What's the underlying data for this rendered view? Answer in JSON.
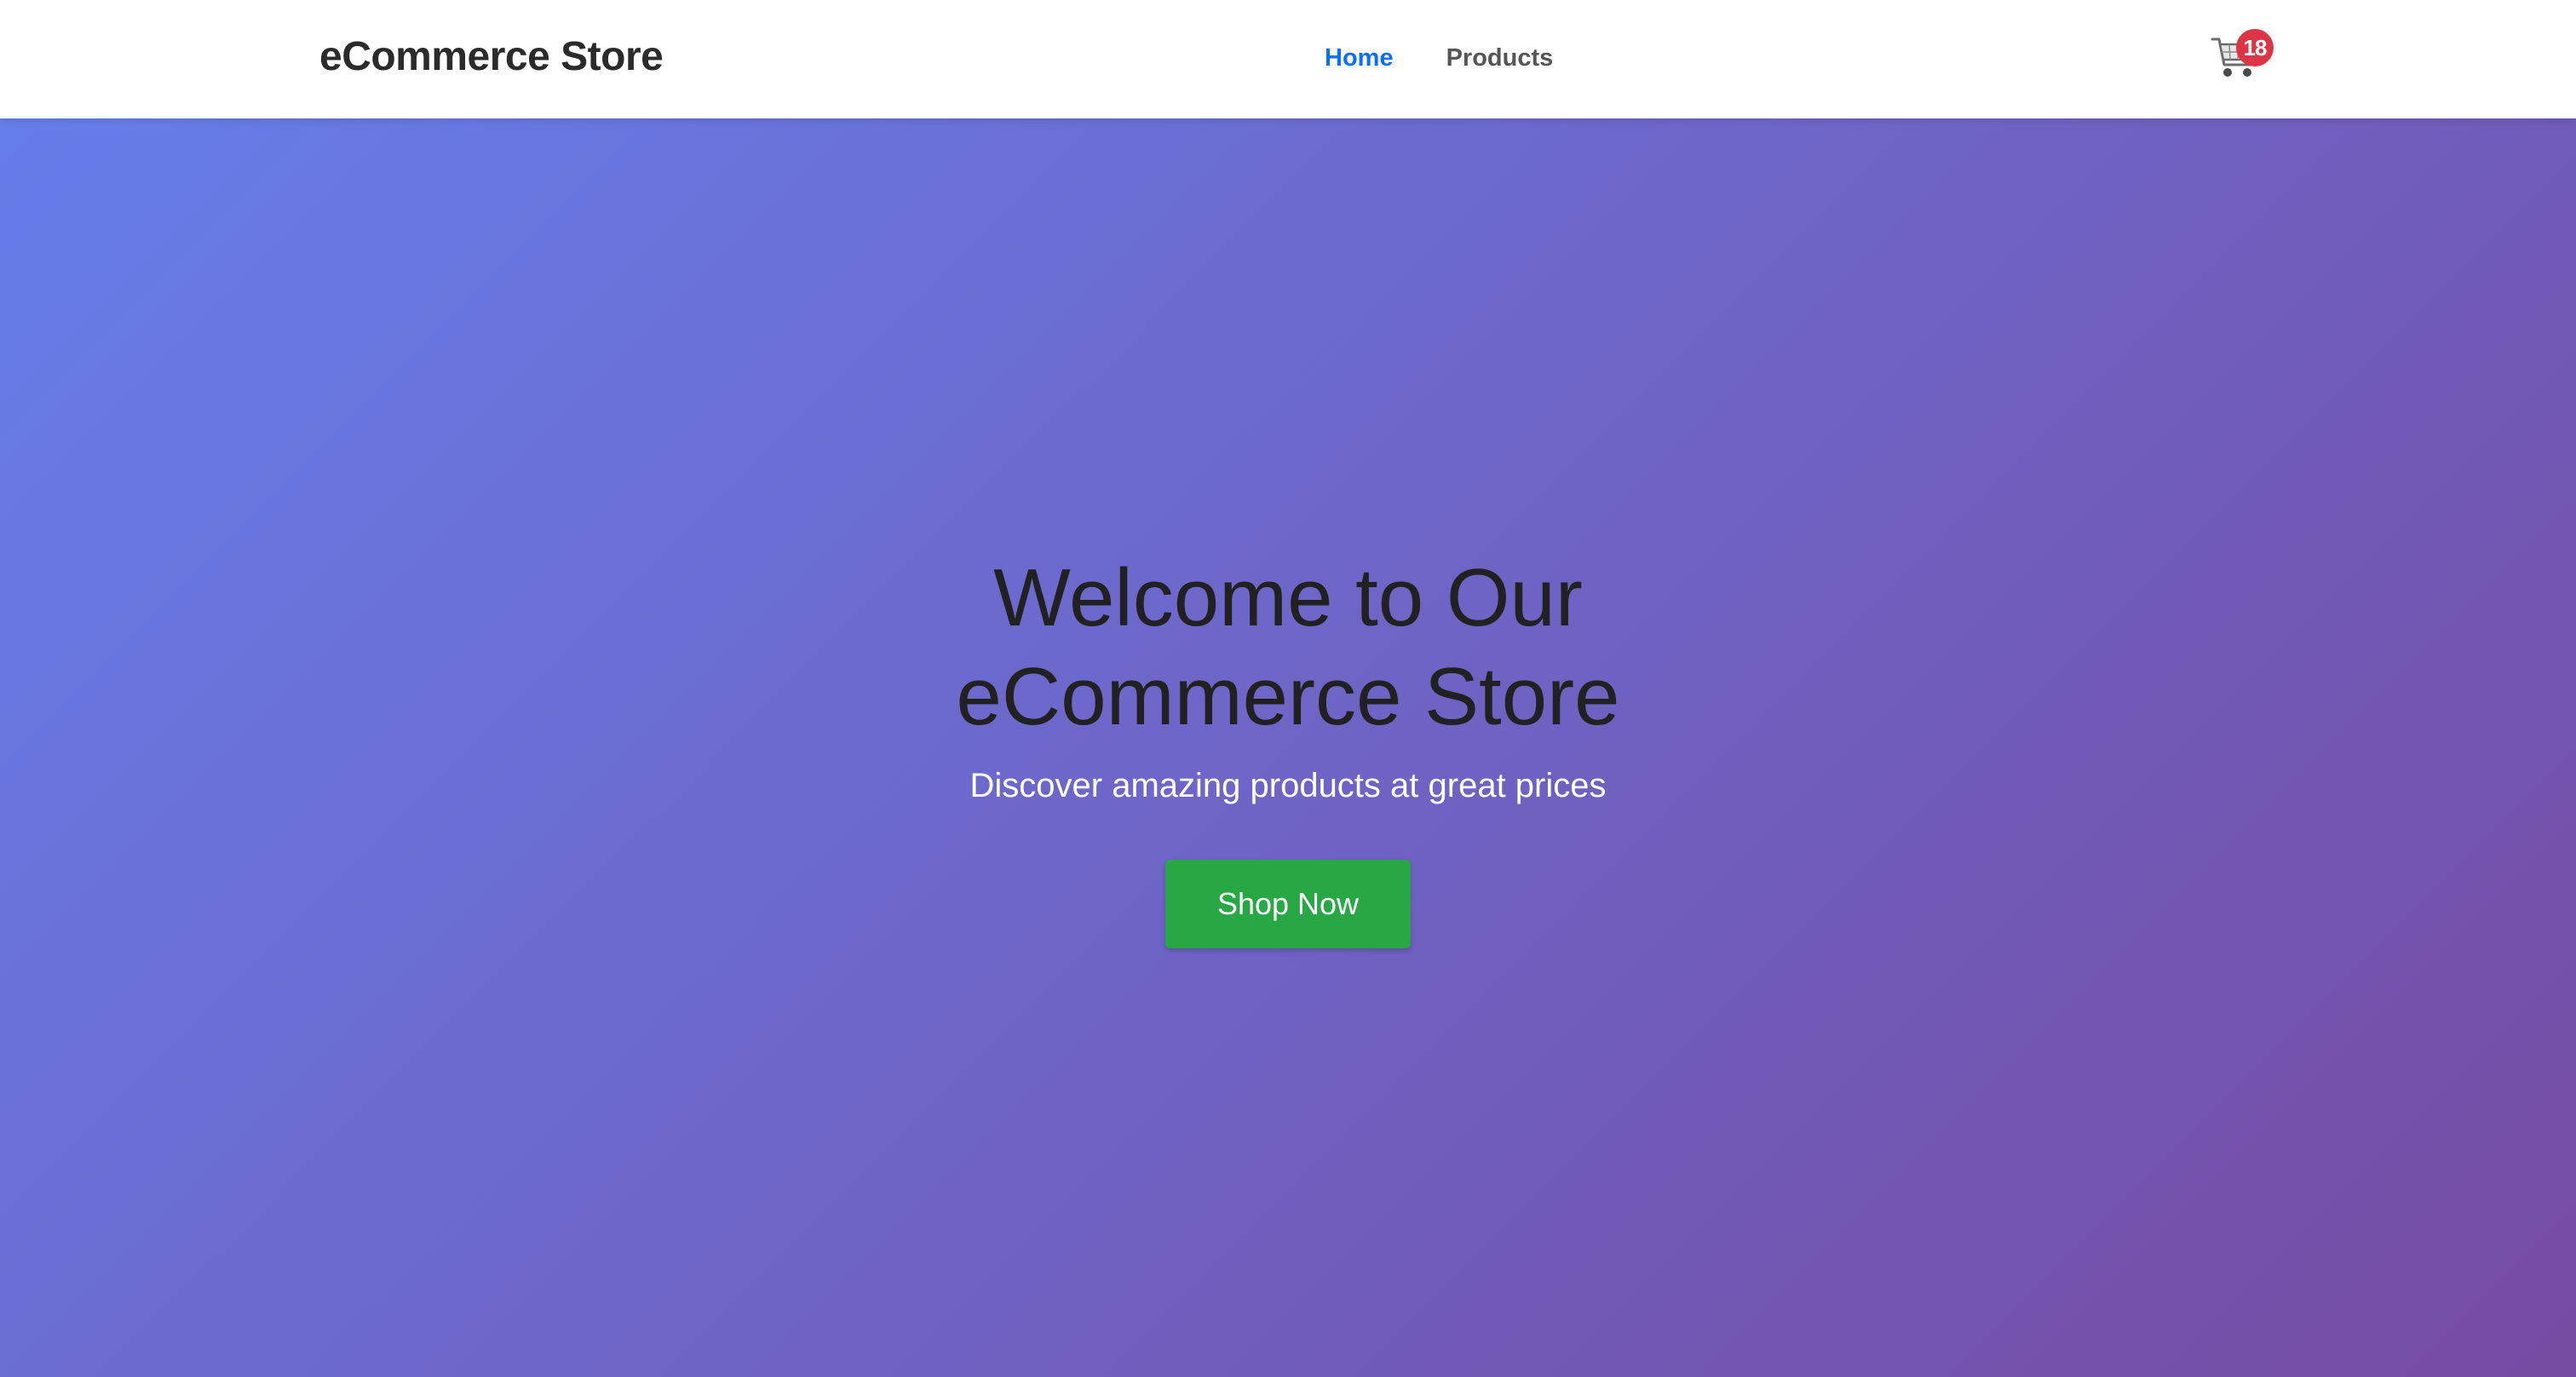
{
  "header": {
    "brand": "eCommerce Store",
    "nav": {
      "home": "Home",
      "products": "Products"
    },
    "cart": {
      "icon": "shopping-cart-icon",
      "count": "18"
    }
  },
  "hero": {
    "title_line1": "Welcome to Our",
    "title_line2": "eCommerce Store",
    "subtitle": "Discover amazing products at great prices",
    "cta_label": "Shop Now"
  },
  "colors": {
    "gradient_start": "#667eea",
    "gradient_end": "#764ba2",
    "active_link": "#0d6efd",
    "cta": "#28a745",
    "badge": "#dc3545"
  }
}
